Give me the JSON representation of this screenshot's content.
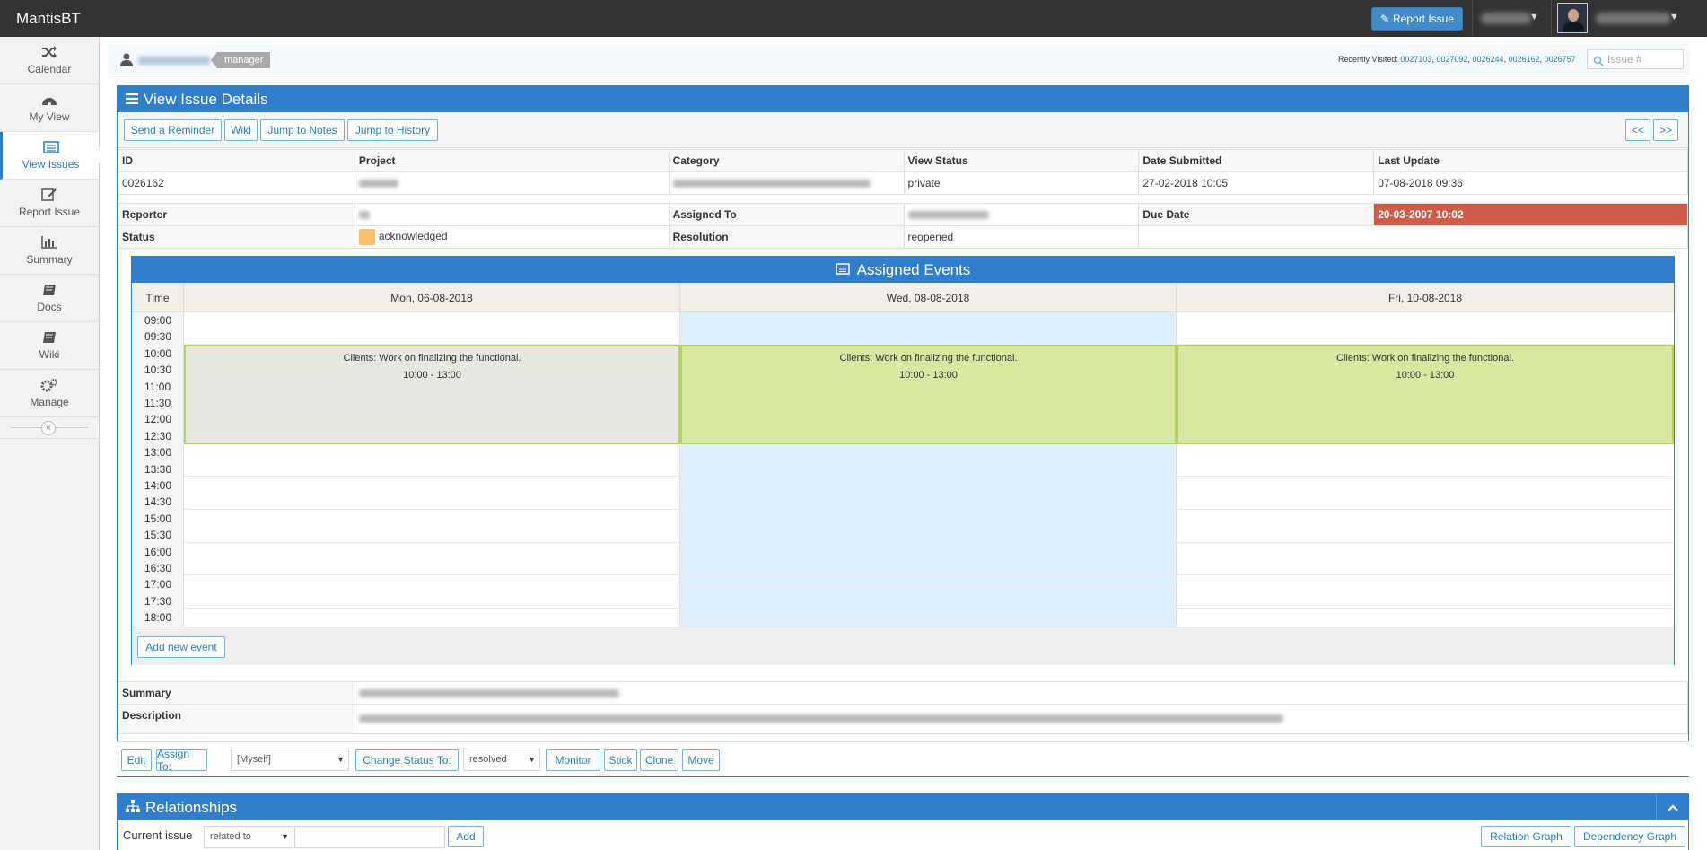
{
  "app": {
    "brand": "MantisBT",
    "report_issue": "Report Issue"
  },
  "sidebar": {
    "items": [
      "Calendar",
      "My View",
      "View Issues",
      "Report Issue",
      "Summary",
      "Docs",
      "Wiki",
      "Manage"
    ]
  },
  "breadcrumbs": {
    "role": "manager",
    "recently_label": "Recently Visited:",
    "recent_ids": [
      "0027103",
      "0027092",
      "0026244",
      "0026162",
      "0026757"
    ],
    "search_placeholder": "Issue #"
  },
  "issue": {
    "widget_title": "View Issue Details",
    "toolbar": [
      "Send a Reminder",
      "Wiki",
      "Jump to Notes",
      "Jump to History"
    ],
    "nav": [
      "<<",
      ">>"
    ],
    "headers": [
      "ID",
      "Project",
      "Category",
      "View Status",
      "Date Submitted",
      "Last Update"
    ],
    "values": {
      "id": "0026162",
      "view_status": "private",
      "date_submitted": "27-02-2018 10:05",
      "last_update": "07-08-2018 09:36"
    },
    "labels": {
      "reporter": "Reporter",
      "assigned_to": "Assigned To",
      "due_date": "Due Date",
      "status": "Status",
      "resolution": "Resolution",
      "summary": "Summary",
      "description": "Description"
    },
    "due_date": "20-03-2007 10:02",
    "status": "acknowledged",
    "resolution": "reopened",
    "status_color": "#fcbd6f"
  },
  "events": {
    "title": "Assigned Events",
    "time_header": "Time",
    "days": [
      "Mon, 06-08-2018",
      "Wed, 08-08-2018",
      "Fri, 10-08-2018"
    ],
    "times": [
      "09:00",
      "09:30",
      "10:00",
      "10:30",
      "11:00",
      "11:30",
      "12:00",
      "12:30",
      "13:00",
      "13:30",
      "14:00",
      "14:30",
      "15:00",
      "15:30",
      "16:00",
      "16:30",
      "17:00",
      "17:30",
      "18:00"
    ],
    "event_text": "Clients: Work on finalizing the functional.",
    "event_time": "10:00 - 13:00",
    "add_button": "Add new event"
  },
  "actions": {
    "edit": "Edit",
    "assign_to": "Assign To:",
    "assign_value": "[Myself]",
    "change_status": "Change Status To:",
    "status_value": "resolved",
    "monitor": "Monitor",
    "stick": "Stick",
    "clone": "Clone",
    "move": "Move"
  },
  "relationships": {
    "title": "Relationships",
    "current_issue": "Current issue",
    "relation_value": "related to",
    "add": "Add",
    "relation_graph": "Relation Graph",
    "dependency_graph": "Dependency Graph"
  }
}
